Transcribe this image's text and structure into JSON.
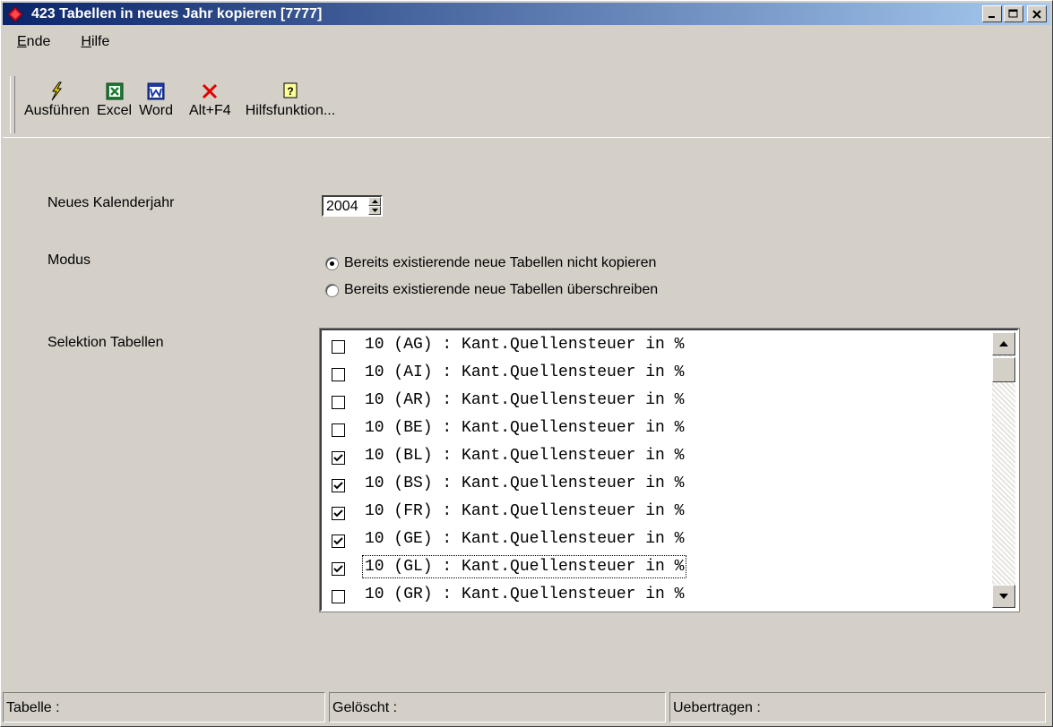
{
  "window": {
    "title": "423 Tabellen in neues Jahr kopieren [7777]"
  },
  "menu": [
    {
      "label_u": "E",
      "label_rest": "nde"
    },
    {
      "label_u": "H",
      "label_rest": "ilfe"
    }
  ],
  "toolbar": {
    "run_label": "Ausführen",
    "excel_label": "Excel",
    "word_label": "Word",
    "close_label": "Alt+F4",
    "help_label": "Hilfsfunktion..."
  },
  "form": {
    "year_label": "Neues Kalenderjahr",
    "year_value": "2004",
    "mode_label": "Modus",
    "mode_options": [
      "Bereits existierende neue Tabellen nicht kopieren",
      "Bereits existierende neue Tabellen überschreiben"
    ],
    "mode_selected": 0,
    "selection_label": "Selektion Tabellen"
  },
  "tables": [
    {
      "text": "10 (AG) : Kant.Quellensteuer in %",
      "checked": false
    },
    {
      "text": "10 (AI) : Kant.Quellensteuer in %",
      "checked": false
    },
    {
      "text": "10 (AR) : Kant.Quellensteuer in %",
      "checked": false
    },
    {
      "text": "10 (BE) : Kant.Quellensteuer in %",
      "checked": false
    },
    {
      "text": "10 (BL) : Kant.Quellensteuer in %",
      "checked": true
    },
    {
      "text": "10 (BS) : Kant.Quellensteuer in %",
      "checked": true
    },
    {
      "text": "10 (FR) : Kant.Quellensteuer in %",
      "checked": true
    },
    {
      "text": "10 (GE) : Kant.Quellensteuer in %",
      "checked": true
    },
    {
      "text": "10 (GL) : Kant.Quellensteuer in %",
      "checked": true,
      "focused": true
    },
    {
      "text": "10 (GR) : Kant.Quellensteuer in %",
      "checked": false
    }
  ],
  "status": {
    "table_label": "Tabelle :",
    "deleted_label": "Gelöscht :",
    "transferred_label": "Uebertragen :"
  },
  "colors": {
    "titlebar_start": "#0a246a",
    "titlebar_end": "#a6caf0",
    "face": "#d4d0c8"
  }
}
